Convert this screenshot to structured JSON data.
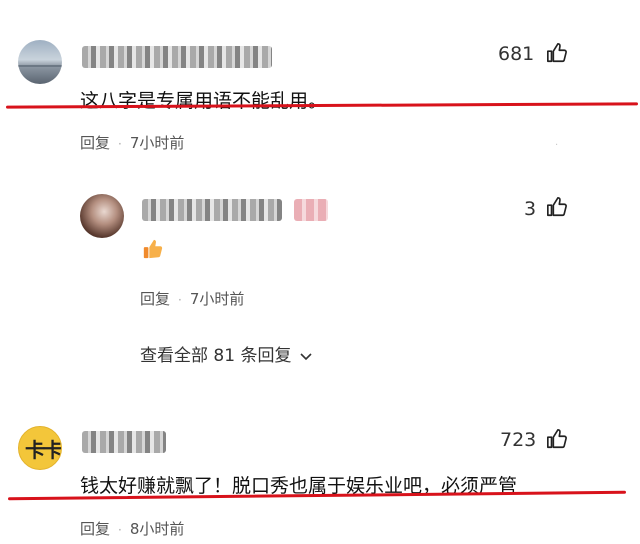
{
  "comments": [
    {
      "likes": "681",
      "text": "这八字是专属用语不能乱用。",
      "reply_label": "回复",
      "time": "7小时前"
    },
    {
      "likes": "3",
      "reply_label": "回复",
      "time": "7小时前",
      "view_all": "查看全部 81 条回复"
    },
    {
      "likes": "723",
      "text": "钱太好赚就飘了！脱口秀也属于娱乐业吧，必须严管",
      "reply_label": "回复",
      "time": "8小时前"
    }
  ],
  "avatar3_text": "卡卡",
  "colors": {
    "underline": "#d8121b",
    "avatar3_bg": "#f3c63a"
  },
  "icons": [
    "thumbs-up-icon",
    "chevron-down-icon",
    "thumbs-up-emoji-icon"
  ]
}
